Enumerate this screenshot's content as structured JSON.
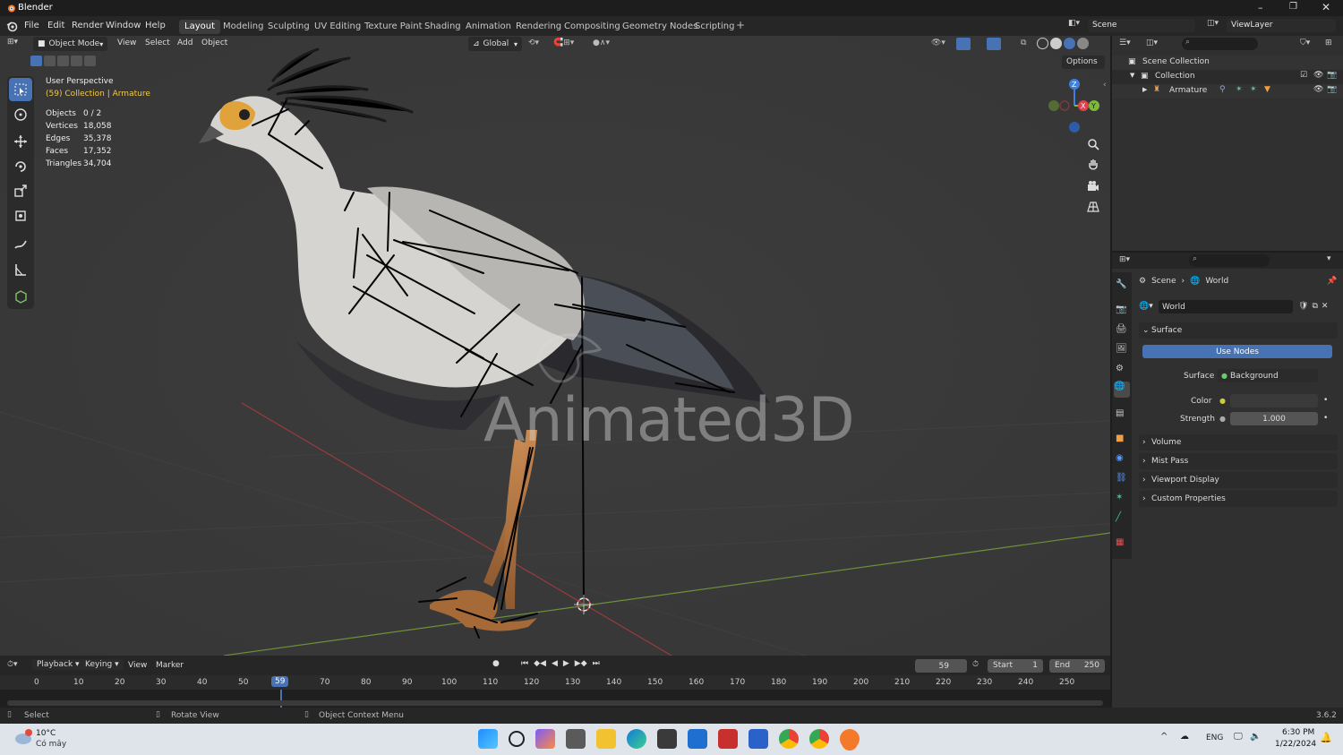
{
  "title": "Blender",
  "menu": [
    "File",
    "Edit",
    "Render",
    "Window",
    "Help"
  ],
  "workspaces": [
    "Layout",
    "Modeling",
    "Sculpting",
    "UV Editing",
    "Texture Paint",
    "Shading",
    "Animation",
    "Rendering",
    "Compositing",
    "Geometry Nodes",
    "Scripting"
  ],
  "scene_name": "Scene",
  "view_layer": "ViewLayer",
  "viewport_header": {
    "mode": "Object Mode",
    "view": "View",
    "select": "Select",
    "add": "Add",
    "object": "Object",
    "orientation": "Global",
    "options": "Options"
  },
  "overlay": {
    "perspective": "User Perspective",
    "collection": "(59) Collection | Armature"
  },
  "stats": [
    {
      "label": "Objects",
      "value": "0 / 2"
    },
    {
      "label": "Vertices",
      "value": "18,058"
    },
    {
      "label": "Edges",
      "value": "35,378"
    },
    {
      "label": "Faces",
      "value": "17,352"
    },
    {
      "label": "Triangles",
      "value": "34,704"
    }
  ],
  "watermark": "Animated3D",
  "outliner": {
    "scene_collection": "Scene Collection",
    "collection": "Collection",
    "armature": "Armature"
  },
  "properties": {
    "breadcrumb": [
      "Scene",
      "World"
    ],
    "world_name": "World",
    "surface_panel": "Surface",
    "use_nodes": "Use Nodes",
    "surface_label": "Surface",
    "surface_value": "Background",
    "color_label": "Color",
    "strength_label": "Strength",
    "strength_value": "1.000",
    "panels": [
      "Volume",
      "Mist Pass",
      "Viewport Display",
      "Custom Properties"
    ]
  },
  "timeline": {
    "playback": "Playback",
    "keying": "Keying",
    "view": "View",
    "marker": "Marker",
    "current_frame": "59",
    "start_label": "Start",
    "start": "1",
    "end_label": "End",
    "end": "250",
    "ticks": [
      "0",
      "10",
      "20",
      "30",
      "40",
      "50",
      "59",
      "70",
      "80",
      "90",
      "100",
      "110",
      "120",
      "130",
      "140",
      "150",
      "160",
      "170",
      "180",
      "190",
      "200",
      "210",
      "220",
      "230",
      "240",
      "250"
    ]
  },
  "statusbar": {
    "select": "Select",
    "rotate": "Rotate View",
    "context": "Object Context Menu",
    "version": "3.6.2"
  },
  "taskbar": {
    "temp": "10°C",
    "weather": "Có mây",
    "lang": "ENG",
    "time": "6:30 PM",
    "date": "1/22/2024"
  },
  "colors": {
    "accent": "#4772b3",
    "axis_x": "#e0404b",
    "axis_y": "#7fb83a",
    "axis_z": "#3f7fe0"
  }
}
